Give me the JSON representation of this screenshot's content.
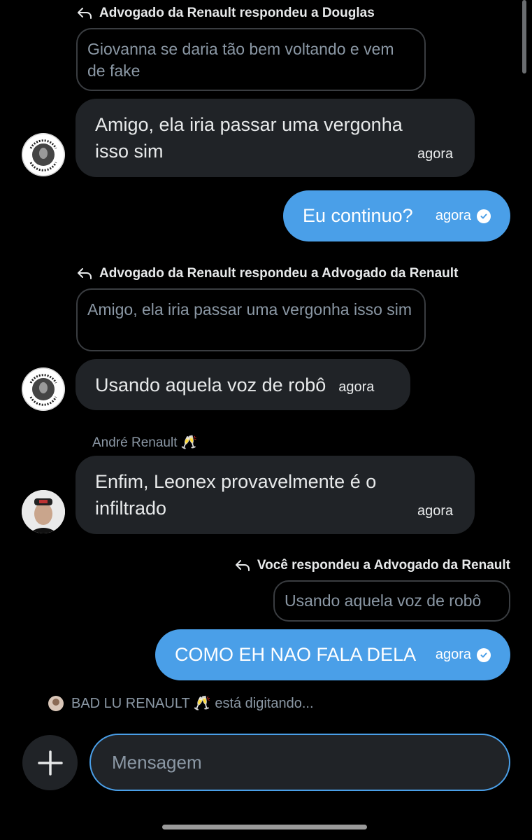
{
  "messages": {
    "reply1": {
      "header": "Advogado da Renault respondeu a Douglas",
      "quote": "Giovanna se daria tão bem voltando e vem de fake"
    },
    "msg1": {
      "line1": "Amigo, ela iria passar uma vergonha",
      "line2": "isso sim",
      "time": "agora",
      "avatar_icon": "blackout-avatar"
    },
    "out1": {
      "text": "Eu continuo?",
      "time": "agora"
    },
    "reply2": {
      "header": "Advogado da Renault respondeu a Advogado da Renault",
      "quote": "Amigo, ela iria passar uma vergonha isso sim"
    },
    "msg2": {
      "text": "Usando aquela voz de robô",
      "time": "agora"
    },
    "msg3": {
      "sender": "André Renault 🥂",
      "line1": "Enfim, Leonex provavelmente é o",
      "line2": "infiltrado",
      "time": "agora"
    },
    "reply3": {
      "header": "Você respondeu a Advogado da Renault",
      "quote": "Usando aquela voz de robô"
    },
    "out2": {
      "text": "COMO EH NAO FALA DELA",
      "time": "agora"
    }
  },
  "typing": {
    "text": "BAD LU RENAULT 🥂 está digitando..."
  },
  "composer": {
    "placeholder": "Mensagem",
    "add_icon": "plus-icon"
  },
  "colors": {
    "background": "#000000",
    "incoming_bubble": "#202327",
    "outgoing_bubble": "#4a9fe8",
    "input_border": "#4a9fe8"
  }
}
